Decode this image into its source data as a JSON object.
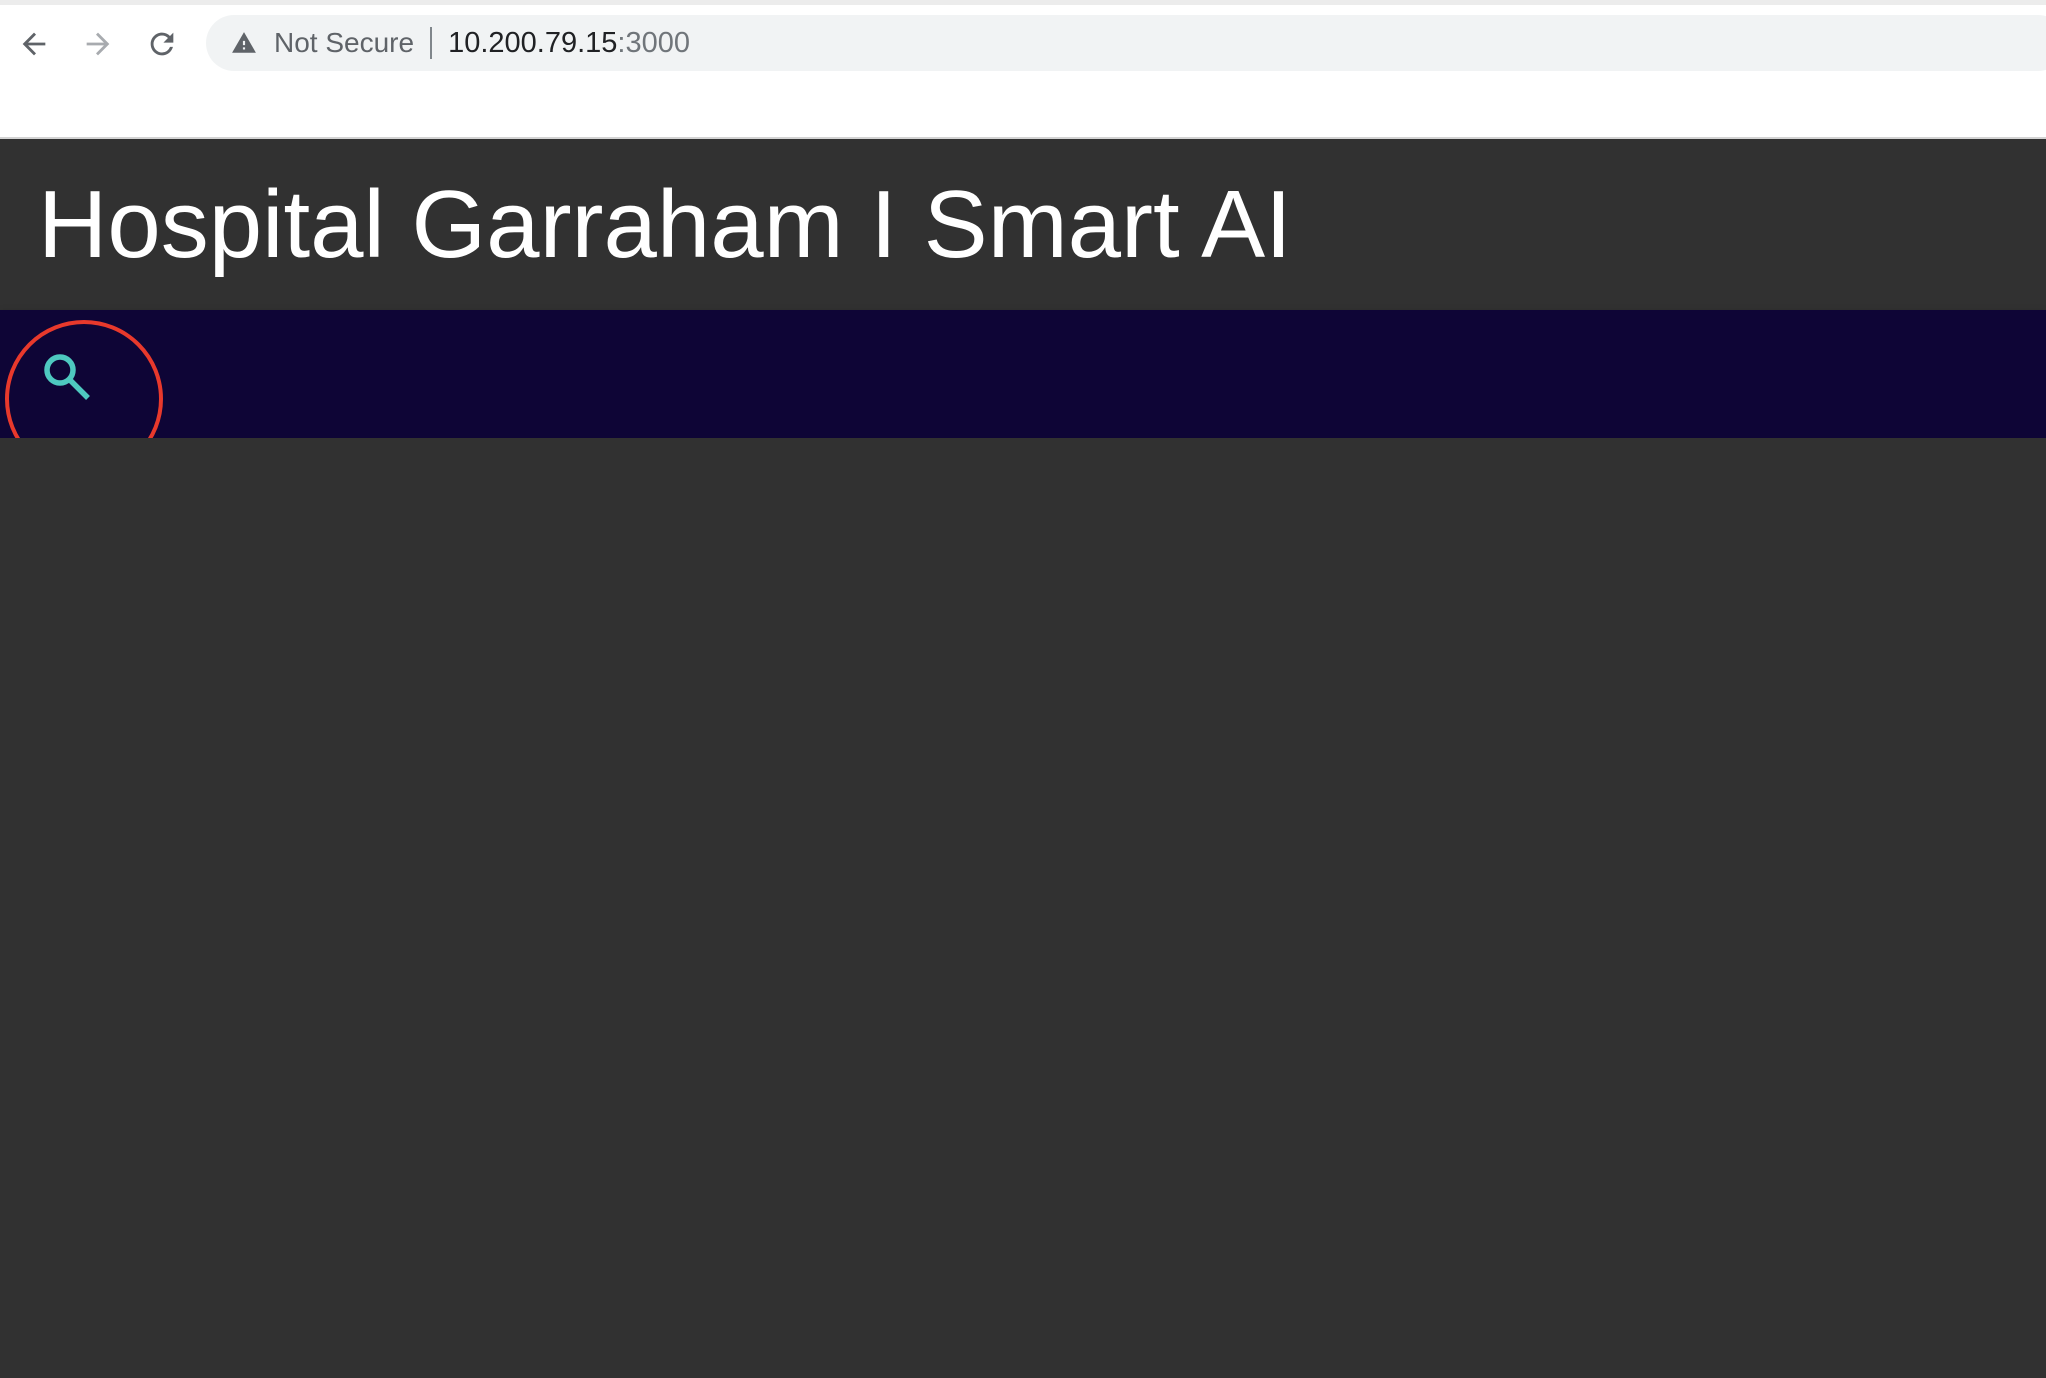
{
  "browser": {
    "security_label": "Not Secure",
    "url_host": "10.200.79.15",
    "url_port": ":3000",
    "icons": {
      "back": "arrow-left-icon",
      "forward": "arrow-right-icon",
      "reload": "reload-icon",
      "security": "warning-triangle-icon"
    }
  },
  "header": {
    "title": "Hospital Garraham I Smart AI"
  },
  "search_bar": {
    "icon": "search-icon",
    "icon_color": "#4ec9c0",
    "background_color": "#0e0536"
  },
  "annotation": {
    "highlight_color": "#e8392c"
  },
  "colors": {
    "page_background": "#313131",
    "title_color": "#ffffff"
  }
}
